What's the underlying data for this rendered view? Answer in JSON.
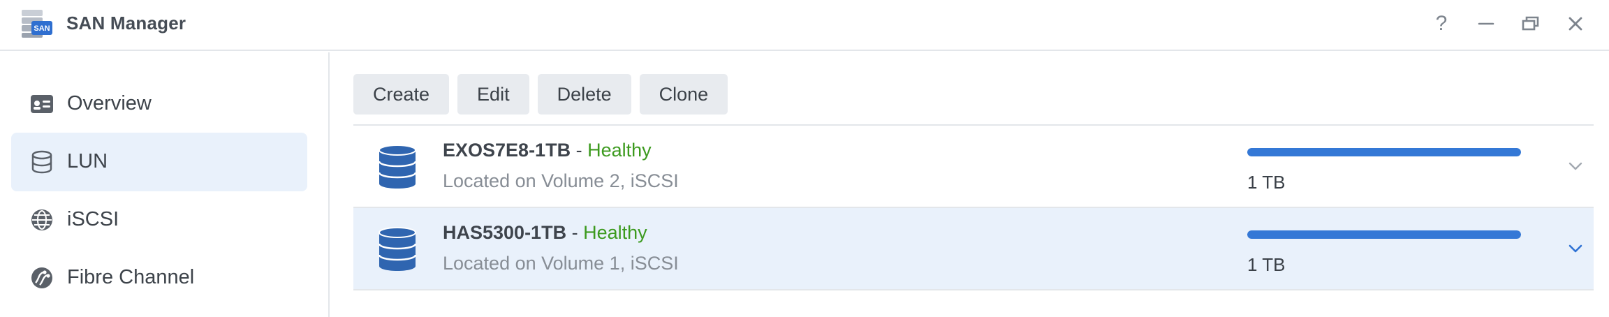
{
  "window": {
    "title": "SAN Manager",
    "app_icon": "san-storage-icon",
    "app_icon_badge": "SAN",
    "controls": [
      "help-icon",
      "minimize-icon",
      "restore-icon",
      "close-icon"
    ],
    "help_glyph": "?"
  },
  "sidebar": {
    "items": [
      {
        "label": "Overview",
        "icon": "overview-card-icon",
        "active": false
      },
      {
        "label": "LUN",
        "icon": "database-icon",
        "active": true
      },
      {
        "label": "iSCSI",
        "icon": "globe-icon",
        "active": false
      },
      {
        "label": "Fibre Channel",
        "icon": "fibre-channel-icon",
        "active": false
      }
    ]
  },
  "toolbar": {
    "create_label": "Create",
    "edit_label": "Edit",
    "delete_label": "Delete",
    "clone_label": "Clone"
  },
  "luns": [
    {
      "name": "EXOS7E8-1TB",
      "separator": " - ",
      "status": "Healthy",
      "location": "Located on Volume 2, iSCSI",
      "size": "1 TB",
      "usage_fraction": 1.0,
      "selected": false
    },
    {
      "name": "HAS5300-1TB",
      "separator": " - ",
      "status": "Healthy",
      "location": "Located on Volume 1, iSCSI",
      "size": "1 TB",
      "usage_fraction": 1.0,
      "selected": true
    }
  ],
  "colors": {
    "accent": "#3478d6",
    "healthy": "#3c9a1e",
    "selected_bg": "#e9f1fb",
    "db_icon": "#2f65b0"
  }
}
